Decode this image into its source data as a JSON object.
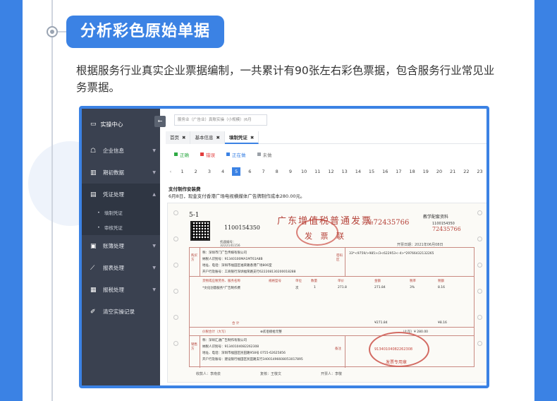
{
  "heading": {
    "title": "分析彩色原始单据",
    "description": "根据服务行业真实企业票据编制，一共累计有90张左右彩色票据，包含服务行业常见业务票据。"
  },
  "app": {
    "sidebar": {
      "header": "实操中心",
      "items": [
        {
          "label": "企业信息",
          "icon": "building-icon"
        },
        {
          "label": "期初数据",
          "icon": "chart-icon"
        },
        {
          "label": "凭证处理",
          "icon": "voucher-icon",
          "expanded": true,
          "children": [
            "填制凭证",
            "审核凭证"
          ]
        },
        {
          "label": "账簿处理",
          "icon": "book-icon"
        },
        {
          "label": "报表处理",
          "icon": "report-icon"
        },
        {
          "label": "报税处理",
          "icon": "tax-icon"
        },
        {
          "label": "清空实操记录",
          "icon": "clear-icon"
        }
      ]
    },
    "toggle_label": "←",
    "search_text": "服务业（广告业）真账实操（小规模）(6月",
    "tabs": [
      {
        "label": "首页",
        "active": false
      },
      {
        "label": "基本信息",
        "active": false
      },
      {
        "label": "填制凭证",
        "active": true
      }
    ],
    "tab_close": "✖",
    "legend": [
      {
        "label": "正确",
        "color": "#2eaa44"
      },
      {
        "label": "错误",
        "color": "#e23c3c"
      },
      {
        "label": "正在做",
        "color": "#3b82e4"
      },
      {
        "label": "未做",
        "color": "#9aa0a8"
      }
    ],
    "pager": {
      "prev": "‹",
      "pages": [
        "1",
        "2",
        "3",
        "4",
        "5",
        "6",
        "7",
        "8",
        "9",
        "10",
        "11",
        "12",
        "13",
        "14",
        "15",
        "16",
        "17",
        "18",
        "19",
        "20",
        "21",
        "22",
        "23"
      ],
      "current": "5"
    },
    "task": {
      "title": "支付制作安装费",
      "description": "6月8日，现金支付香港广场电视横媒体广告牌制作成本280.00元。"
    },
    "invoice": {
      "serial": "5-1",
      "code": "1100154350",
      "machine_no": "机器编号：",
      "machine_no_value": "3222141156",
      "title": "广东增值税普通发票",
      "copy_name": "发 票 联",
      "number": "№72435766",
      "right_note": "教学配套资料",
      "right_code1": "1100154350",
      "right_code2": "72435766",
      "date": "开票日期：2021年06月08日",
      "buyer_label": "购买方",
      "buyer_name": "称：深圳市门广告传媒有限公司",
      "buyer_tax": "纳税人识别号：91340100MA1MT61A8B",
      "buyer_addr": "地址、电话：深圳市福田区福荣路香港广场806室",
      "buyer_bank": "开户行及账号：工商银行深圳福荣路支行622208130200018288",
      "cipher_label": "密码区",
      "cipher": "33*<9759/>985>/3<622953<-4>*2976643213226​5",
      "item_header": [
        "货物或应税劳务、服务名称",
        "规格型号",
        "单位",
        "数量",
        "单价",
        "金额",
        "税率",
        "税额"
      ],
      "item": [
        "*文化创意服务*广告制作费",
        "",
        "次",
        "1",
        "271.8",
        "271.84",
        "3%",
        "8.16"
      ],
      "total_row": [
        "合 计",
        "¥271.84",
        "¥8.16"
      ],
      "grand_label": "价税合计（大写）",
      "grand_words": "⊗贰佰捌拾元整",
      "grand_small": "（小写）¥ 280.00",
      "seller_label": "销售方",
      "seller_name": "称：深圳汇通广告制作有限公司",
      "seller_tax": "纳税人识别号：91340104082262308",
      "seller_addr": "地址、电话：深圳市福田区民田路958号 0755-62625856",
      "seller_bank": "开户行及账号：建设银行福田区民田路支行34001496608053017895",
      "note_label": "备注",
      "stamp_text": "91340104082262308",
      "stamp_bottom": "发票专用章",
      "footer": [
        "收款人：李南泉",
        "复核：王敬文",
        "开票人：李敬"
      ]
    }
  }
}
